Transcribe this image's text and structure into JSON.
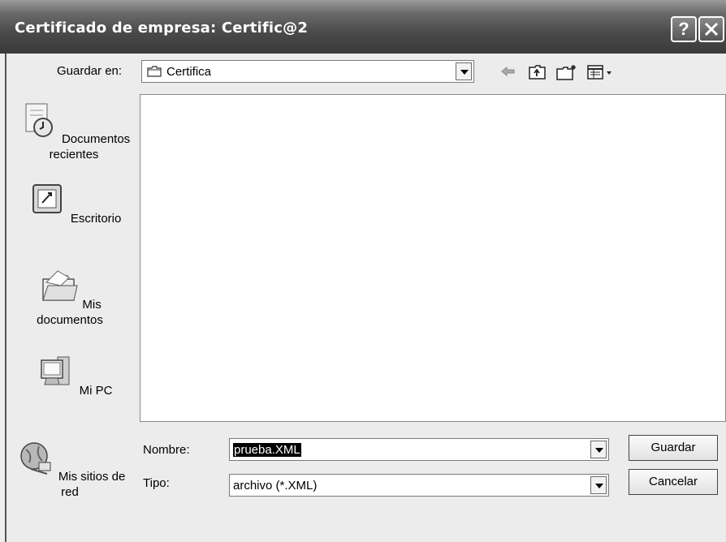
{
  "window": {
    "title": "Certificado de empresa: Certific@2",
    "help_label": "?",
    "close_label": "✕"
  },
  "toolbar": {
    "save_in_label": "Guardar en:",
    "folder_value": "Certifica",
    "back_icon": "back-arrow-icon",
    "up_icon": "up-folder-icon",
    "new_folder_icon": "new-folder-icon",
    "views_icon": "views-menu-icon"
  },
  "places": [
    {
      "label": "Documentos recientes",
      "icon": "recent-documents-icon"
    },
    {
      "label": "Escritorio",
      "icon": "desktop-icon"
    },
    {
      "label": "Mis documentos",
      "icon": "my-documents-icon"
    },
    {
      "label": "Mi PC",
      "icon": "my-computer-icon"
    },
    {
      "label": "Mis sitios de red",
      "icon": "network-places-icon"
    }
  ],
  "form": {
    "name_label": "Nombre:",
    "name_value": "prueba.XML",
    "type_label": "Tipo:",
    "type_value": "archivo (*.XML)"
  },
  "buttons": {
    "save": "Guardar",
    "cancel": "Cancelar"
  }
}
